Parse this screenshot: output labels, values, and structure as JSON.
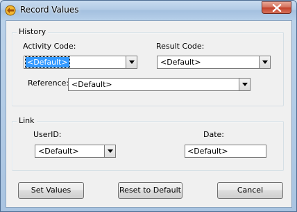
{
  "window": {
    "title": "Record Values"
  },
  "history": {
    "group_label": "History",
    "activity_code": {
      "label": "Activity Code:",
      "value": "<Default>"
    },
    "result_code": {
      "label": "Result Code:",
      "value": "<Default>"
    },
    "reference": {
      "label": "Reference:",
      "value": "<Default>"
    }
  },
  "link": {
    "group_label": "Link",
    "user_id": {
      "label": "UserID:",
      "value": "<Default>"
    },
    "date": {
      "label": "Date:",
      "value": "<Default>"
    }
  },
  "buttons": {
    "set_values": "Set Values",
    "reset": "Reset to Default",
    "cancel": "Cancel"
  },
  "colors": {
    "selection": "#3399ff",
    "close_button": "#c4422b",
    "title_bar": "#b2cbe6"
  }
}
